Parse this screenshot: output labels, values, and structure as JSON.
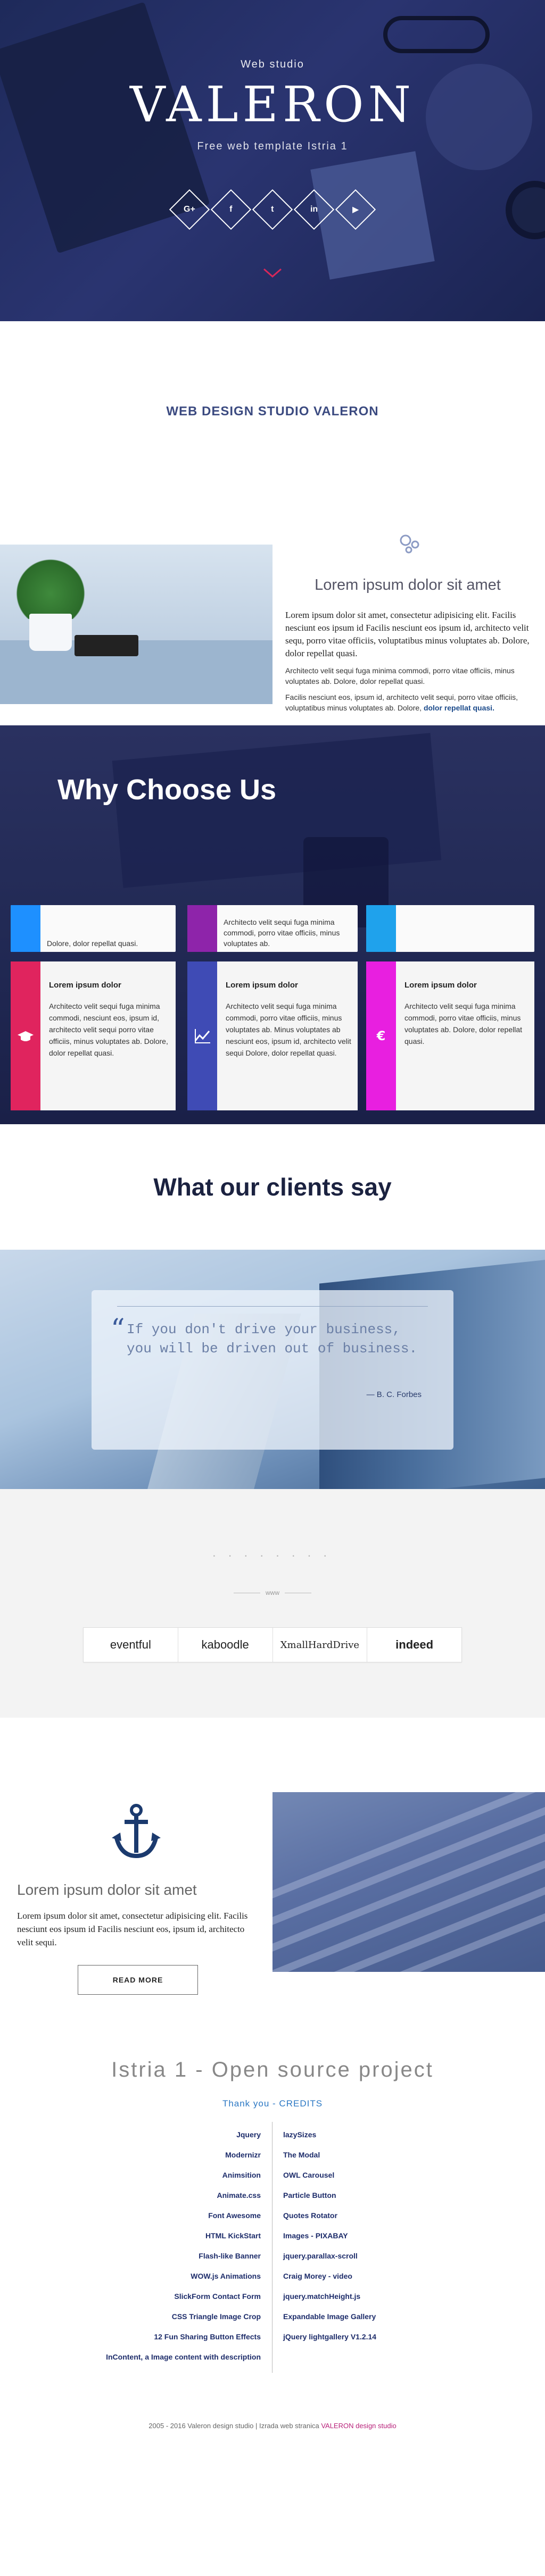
{
  "hero": {
    "subtitle": "Web studio",
    "title": "VALERON",
    "tagline": "Free web template Istria 1",
    "social": [
      {
        "icon": "google-plus-icon",
        "glyph": "G+"
      },
      {
        "icon": "facebook-icon",
        "glyph": "f"
      },
      {
        "icon": "twitter-icon",
        "glyph": "t"
      },
      {
        "icon": "linkedin-icon",
        "glyph": "in"
      },
      {
        "icon": "youtube-icon",
        "glyph": "▶"
      }
    ],
    "accent": "#d8275a"
  },
  "studio": {
    "heading": "WEB DESIGN STUDIO VALERON"
  },
  "about": {
    "heading": "Lorem ipsum dolor sit amet",
    "p1": "Lorem ipsum dolor sit amet, consectetur adipisicing elit. Facilis nesciunt eos ipsum id Facilis nesciunt eos ipsum id, architecto velit sequ, porro vitae officiis, voluptatibus minus voluptates ab. Dolore, dolor repellat quasi.",
    "p2": "Architecto velit sequi fuga minima commodi, porro vitae officiis, minus voluptates ab. Dolore, dolor repellat quasi.",
    "p3_text": "Facilis nesciunt eos, ipsum id, architecto velit sequi, porro vitae officiis, voluptatibus minus voluptates ab. Dolore, ",
    "p3_link": "dolor repellat quasi."
  },
  "why": {
    "heading": "Why Choose Us",
    "top_cards": [
      {
        "text": "Dolore, dolor repellat quasi.",
        "color": "#1e90ff"
      },
      {
        "text": "Architecto velit sequi fuga minima commodi, porro vitae officiis, minus voluptates ab.",
        "color": "#8e24aa"
      },
      {
        "text": "",
        "color": "#1fa2ec"
      }
    ],
    "cards": [
      {
        "title": "Lorem ipsum dolor",
        "text": "Architecto velit sequi fuga minima commodi, nesciunt eos, ipsum id, architecto velit sequi porro vitae officiis, minus voluptates ab. Dolore, dolor repellat quasi.",
        "icon": "graduation-cap-icon",
        "color": "#e0245e"
      },
      {
        "title": "Lorem ipsum dolor",
        "text": "Architecto velit sequi fuga minima commodi, porro vitae officiis, minus voluptates ab. Minus voluptates ab nesciunt eos, ipsum id, architecto velit sequi Dolore, dolor repellat quasi.",
        "icon": "line-chart-icon",
        "color": "#3f4bb5"
      },
      {
        "title": "Lorem ipsum dolor",
        "text": "Architecto velit sequi fuga minima commodi, porro vitae officiis, minus voluptates ab. Dolore, dolor repellat quasi.",
        "icon": "euro-icon",
        "color": "#e81fe0"
      }
    ]
  },
  "clients": {
    "heading": "What our clients say",
    "quote": "If you don't drive your business, you will be driven out of business.",
    "author": "— B. C. Forbes"
  },
  "logos": {
    "faded_text": "· · · · · · · ·",
    "www": "www",
    "items": [
      "eventful",
      "kaboodle",
      "XmallHardDrive",
      "indeed"
    ]
  },
  "feature": {
    "heading": "Lorem ipsum dolor sit amet",
    "text": "Lorem ipsum dolor sit amet, consectetur adipisicing elit. Facilis nesciunt eos ipsum id Facilis nesciunt eos, ipsum id, architecto velit sequi.",
    "button": "READ MORE"
  },
  "open_source": {
    "heading": "Istria 1 - Open source project",
    "thanks": "Thank you - CREDITS",
    "left": [
      "Jquery",
      "Modernizr",
      "Animsition",
      "Animate.css",
      "Font Awesome",
      "HTML KickStart",
      "Flash-like Banner",
      "WOW.js Animations",
      "SlickForm Contact Form",
      "CSS Triangle Image Crop",
      "12 Fun Sharing Button Effects",
      "InContent, a Image content with description"
    ],
    "right": [
      "lazySizes",
      "The Modal",
      "OWL Carousel",
      "Particle Button",
      "Quotes Rotator",
      "Images - PIXABAY",
      "jquery.parallax-scroll",
      "Craig Morey - video",
      "jquery.matchHeight.js",
      "Expandable Image Gallery",
      "jQuery lightgallery V1.2.14"
    ]
  },
  "footer": {
    "text": "2005 - 2016 Valeron design studio | Izrada web stranica ",
    "link": "VALERON design studio"
  }
}
